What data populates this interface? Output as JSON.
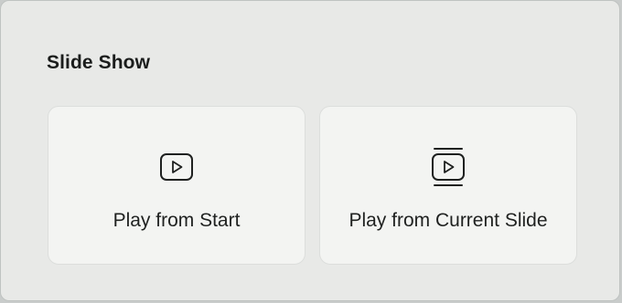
{
  "section": {
    "title": "Slide Show"
  },
  "options": [
    {
      "label": "Play from Start",
      "icon": "play-in-box-icon"
    },
    {
      "label": "Play from Current Slide",
      "icon": "play-current-slide-icon"
    }
  ],
  "colors": {
    "panel_bg": "#e8e9e7",
    "card_bg": "#f3f4f2",
    "text": "#1b1d1c"
  }
}
